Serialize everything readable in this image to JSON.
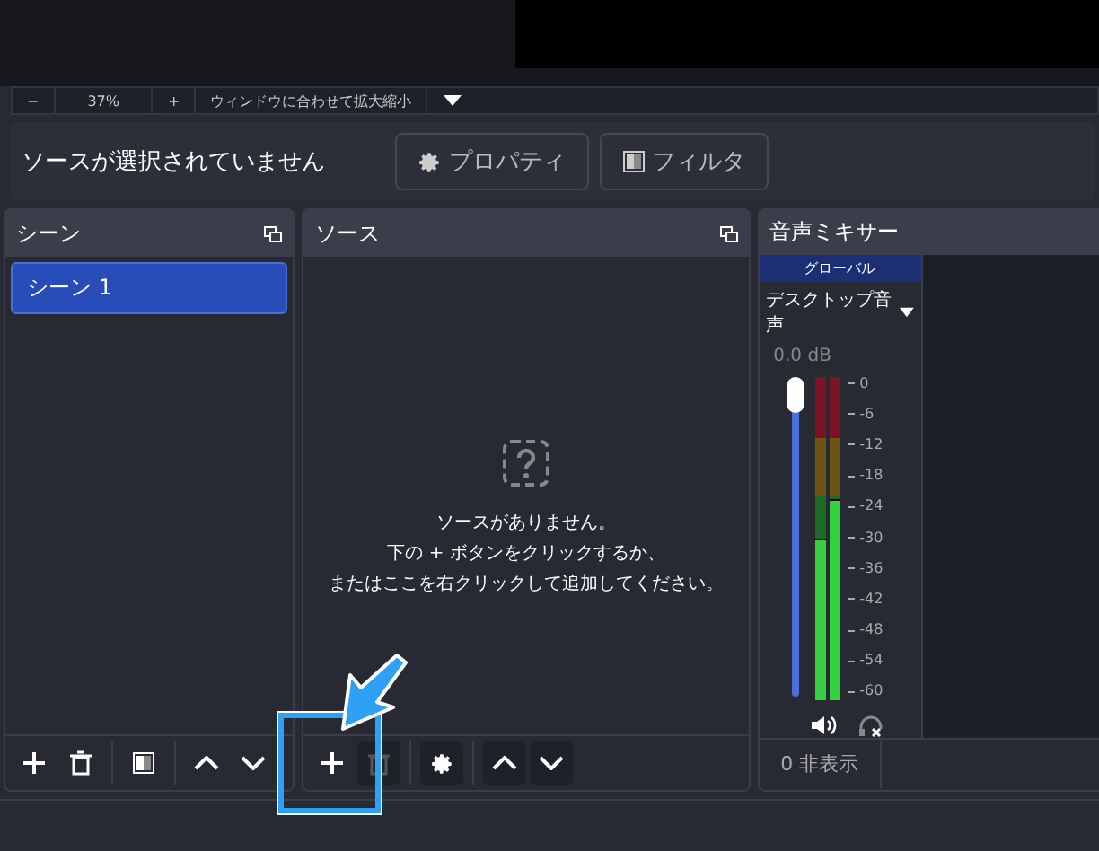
{
  "zoom_bar": {
    "minus": "−",
    "percent": "37%",
    "plus": "+",
    "fit_label": "ウィンドウに合わせて拡大縮小"
  },
  "context_bar": {
    "message": "ソースが選択されていません",
    "buttons": [
      {
        "kind": "gear",
        "label": "プロパティ"
      },
      {
        "kind": "filter",
        "label": "フィルタ"
      }
    ]
  },
  "scenes": {
    "title": "シーン",
    "items": [
      {
        "label": "シーン 1",
        "selected": true
      }
    ],
    "toolbar": [
      {
        "kind": "add"
      },
      {
        "kind": "remove"
      },
      {
        "kind": "filter"
      },
      {
        "kind": "up"
      },
      {
        "kind": "down"
      }
    ]
  },
  "sources": {
    "title": "ソース",
    "empty_lines": [
      "ソースがありません。",
      "下の + ボタンをクリックするか、",
      "またはここを右クリックして追加してください。"
    ],
    "toolbar": [
      {
        "kind": "add"
      },
      {
        "kind": "remove"
      },
      {
        "kind": "gear"
      },
      {
        "kind": "up"
      },
      {
        "kind": "down"
      }
    ]
  },
  "mixer": {
    "title": "音声ミキサー",
    "global_label": "グローバル",
    "channel": {
      "name": "デスクトップ音声",
      "reading": "0.0 dB",
      "level": 1,
      "meters": [
        {
          "level": 0.5
        },
        {
          "level": 0.62
        }
      ],
      "scale": [
        "0",
        "-6",
        "-12",
        "-18",
        "-24",
        "-30",
        "-36",
        "-42",
        "-48",
        "-54",
        "-60"
      ]
    },
    "hidden_count": "0 非表示"
  }
}
